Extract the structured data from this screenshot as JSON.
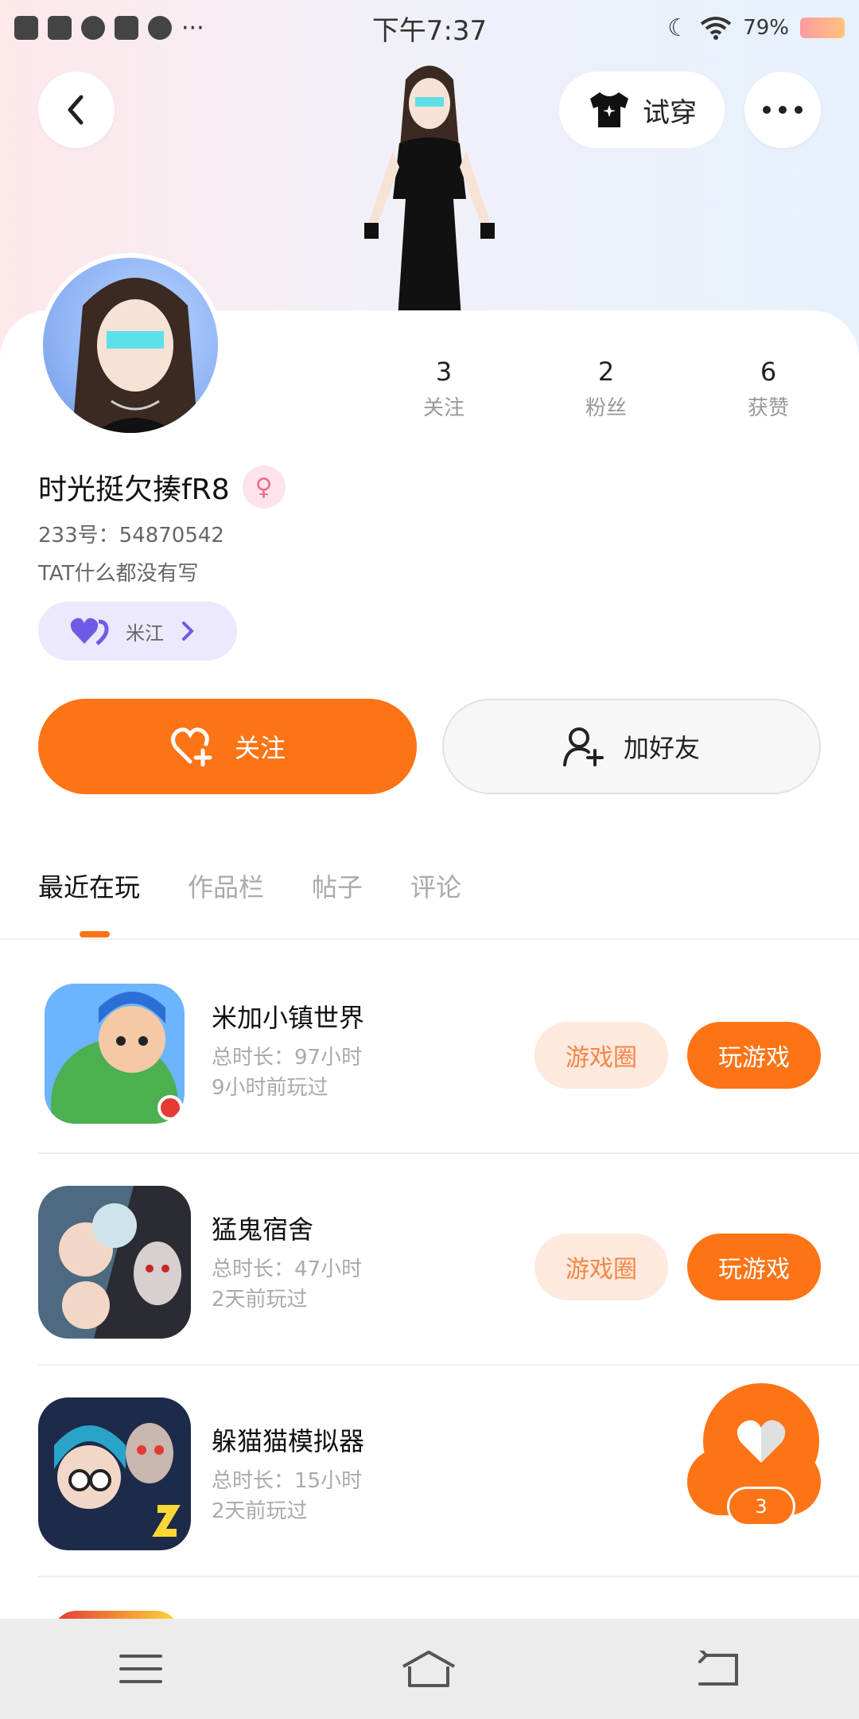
{
  "status_bar": {
    "time": "下午7:37",
    "battery": "79%"
  },
  "header": {
    "try_on_label": "试穿"
  },
  "profile": {
    "stats": [
      {
        "value": "3",
        "label": "关注"
      },
      {
        "value": "2",
        "label": "粉丝"
      },
      {
        "value": "6",
        "label": "获赞"
      }
    ],
    "name": "时光挺欠揍fR8",
    "gender_symbol": "♀",
    "uid": "233号：54870542",
    "bio": "TAT什么都没有写",
    "tag_label": "米江"
  },
  "actions": {
    "follow": "关注",
    "add_friend": "加好友"
  },
  "tabs": [
    {
      "label": "最近在玩"
    },
    {
      "label": "作品栏"
    },
    {
      "label": "帖子"
    },
    {
      "label": "评论"
    }
  ],
  "games": [
    {
      "name": "米加小镇世界",
      "duration": "总时长：97小时",
      "last_played": "9小时前玩过",
      "circle_label": "游戏圈",
      "play_label": "玩游戏"
    },
    {
      "name": "猛鬼宿舍",
      "duration": "总时长：47小时",
      "last_played": "2天前玩过",
      "circle_label": "游戏圈",
      "play_label": "玩游戏"
    },
    {
      "name": "躲猫猫模拟器",
      "duration": "总时长：15小时",
      "last_played": "2天前玩过",
      "circle_label": "",
      "play_label": ""
    }
  ],
  "floating_like": {
    "count": "3"
  },
  "colors": {
    "accent": "#fc7416",
    "accent_light": "#fde9de",
    "tag_bg": "#ebe9fb",
    "tag_heart": "#6e5ce6"
  }
}
